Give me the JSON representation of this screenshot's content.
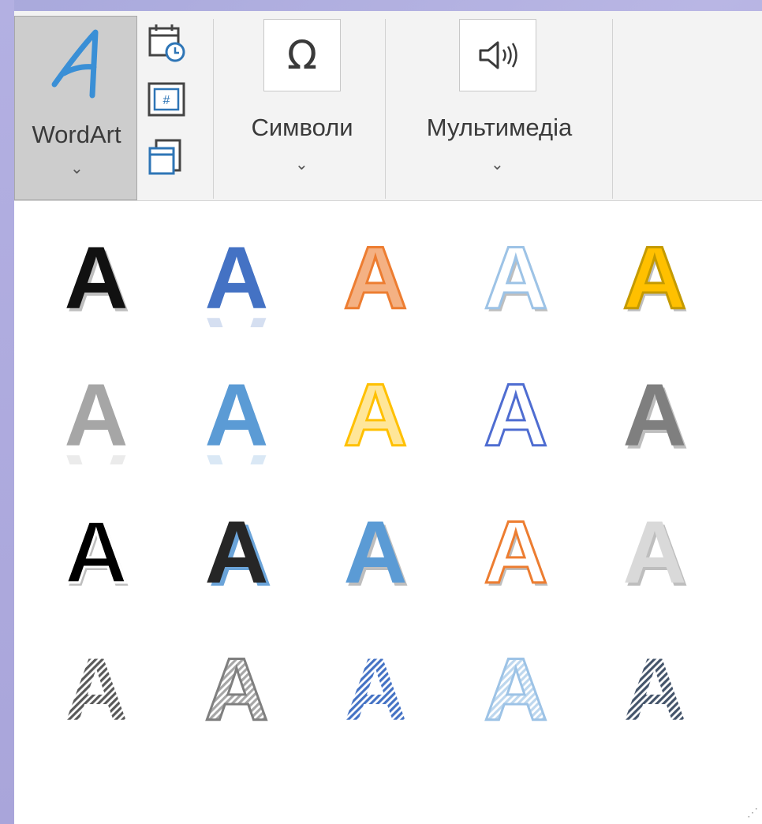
{
  "ribbon": {
    "wordart": {
      "label": "WordArt",
      "chevron": "⌄",
      "icon": "wordart-a-icon",
      "color": "#3a8fd6"
    },
    "small_buttons": [
      {
        "icon": "date-time-icon"
      },
      {
        "icon": "slide-number-icon"
      },
      {
        "icon": "object-icon"
      }
    ],
    "symbols": {
      "label": "Символи",
      "chevron": "⌄",
      "icon": "omega-icon",
      "glyph": "Ω"
    },
    "multimedia": {
      "label": "Мультимедіа",
      "chevron": "⌄",
      "icon": "speaker-icon"
    }
  },
  "gallery": {
    "grip": "⋰",
    "glyph": "A",
    "styles": [
      {
        "name": "fill-black-shadow",
        "fill": "#111111",
        "stroke": "none",
        "effect": "shadow"
      },
      {
        "name": "fill-blue-reflection",
        "fill": "#4472c4",
        "stroke": "none",
        "effect": "reflection"
      },
      {
        "name": "fill-orange-bevel",
        "fill": "#f4b183",
        "stroke": "#ed7d31",
        "effect": "none"
      },
      {
        "name": "outline-lightblue",
        "fill": "#ffffff",
        "stroke": "#9dc3e6",
        "effect": "shadow"
      },
      {
        "name": "fill-gold",
        "fill": "#ffc000",
        "stroke": "#c49a00",
        "effect": "shadow"
      },
      {
        "name": "fill-gray-reflection",
        "fill": "#a6a6a6",
        "stroke": "none",
        "effect": "reflection"
      },
      {
        "name": "fill-blue-gradient-reflection",
        "fill": "#5b9bd5",
        "stroke": "none",
        "effect": "reflection"
      },
      {
        "name": "fill-yellow-outline",
        "fill": "#ffe699",
        "stroke": "#ffc000",
        "effect": "none"
      },
      {
        "name": "outline-purple-blue",
        "fill": "#ffffff",
        "stroke": "#4f6dd1",
        "effect": "none"
      },
      {
        "name": "fill-gray-3d",
        "fill": "#7f7f7f",
        "stroke": "none",
        "effect": "shadow"
      },
      {
        "name": "fill-black-outline-shadow",
        "fill": "#000000",
        "stroke": "#ffffff",
        "effect": "shadow"
      },
      {
        "name": "fill-darkgray-blue-shadow",
        "fill": "#262626",
        "stroke": "none",
        "effect": "blue-shadow"
      },
      {
        "name": "fill-blue-offset",
        "fill": "#5b9bd5",
        "stroke": "none",
        "effect": "shadow"
      },
      {
        "name": "outline-orange",
        "fill": "#ffffff",
        "stroke": "#ed7d31",
        "effect": "shadow"
      },
      {
        "name": "fill-silver",
        "fill": "#d9d9d9",
        "stroke": "none",
        "effect": "shadow"
      },
      {
        "name": "pattern-dark-stripes",
        "fill": "#595959",
        "stroke": "none",
        "effect": "stripes"
      },
      {
        "name": "pattern-gray-stripes",
        "fill": "#a6a6a6",
        "stroke": "#7f7f7f",
        "effect": "stripes"
      },
      {
        "name": "pattern-blue-dots",
        "fill": "#4472c4",
        "stroke": "none",
        "effect": "stripes"
      },
      {
        "name": "pattern-lightblue-stripes",
        "fill": "#bdd7ee",
        "stroke": "#9dc3e6",
        "effect": "stripes"
      },
      {
        "name": "pattern-navy-stripes",
        "fill": "#44546a",
        "stroke": "none",
        "effect": "stripes"
      }
    ]
  }
}
